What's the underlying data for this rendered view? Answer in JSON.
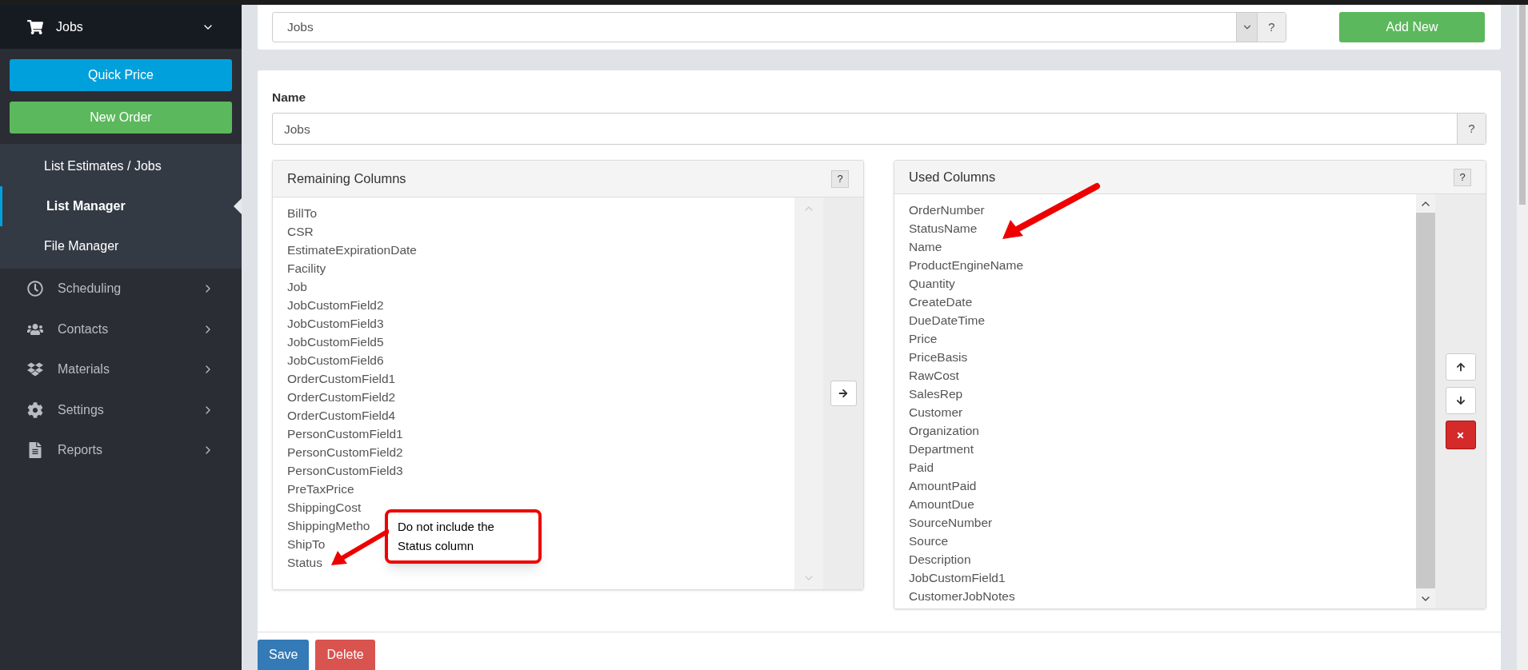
{
  "sidebar": {
    "header": {
      "label": "Jobs",
      "expanded": true
    },
    "buttons": [
      {
        "label": "Quick Price",
        "kind": "info"
      },
      {
        "label": "New Order",
        "kind": "success"
      }
    ],
    "subitems": [
      {
        "label": "List Estimates / Jobs",
        "selected": false
      },
      {
        "label": "List Manager",
        "selected": true
      },
      {
        "label": "File Manager",
        "selected": false
      }
    ],
    "items": [
      {
        "label": "Scheduling",
        "kind": "clock"
      },
      {
        "label": "Contacts",
        "kind": "users"
      },
      {
        "label": "Materials",
        "kind": "boxes"
      },
      {
        "label": "Settings",
        "kind": "gear"
      },
      {
        "label": "Reports",
        "kind": "file"
      }
    ]
  },
  "list_select": {
    "value": "Jobs",
    "help": "?"
  },
  "add_new": "Add New",
  "name_field": {
    "label": "Name",
    "value": "Jobs",
    "help": "?"
  },
  "remaining": {
    "title": "Remaining Columns",
    "help": "?",
    "items": [
      "BillTo",
      "CSR",
      "EstimateExpirationDate",
      "Facility",
      "Job",
      "JobCustomField2",
      "JobCustomField3",
      "JobCustomField5",
      "JobCustomField6",
      "OrderCustomField1",
      "OrderCustomField2",
      "OrderCustomField4",
      "PersonCustomField1",
      "PersonCustomField2",
      "PersonCustomField3",
      "PreTaxPrice",
      "ShippingCost",
      "ShippingMetho",
      "ShipTo",
      "Status"
    ]
  },
  "used": {
    "title": "Used Columns",
    "help": "?",
    "items": [
      "OrderNumber",
      "StatusName",
      "Name",
      "ProductEngineName",
      "Quantity",
      "CreateDate",
      "DueDateTime",
      "Price",
      "PriceBasis",
      "RawCost",
      "SalesRep",
      "Customer",
      "Organization",
      "Department",
      "Paid",
      "AmountPaid",
      "AmountDue",
      "SourceNumber",
      "Source",
      "Description",
      "JobCustomField1",
      "CustomerJobNotes"
    ]
  },
  "callout": {
    "text": "Do not include the Status column"
  },
  "footer_buttons": [
    {
      "label": "Save",
      "kind": "primary"
    },
    {
      "label": "Delete",
      "kind": "danger"
    }
  ]
}
